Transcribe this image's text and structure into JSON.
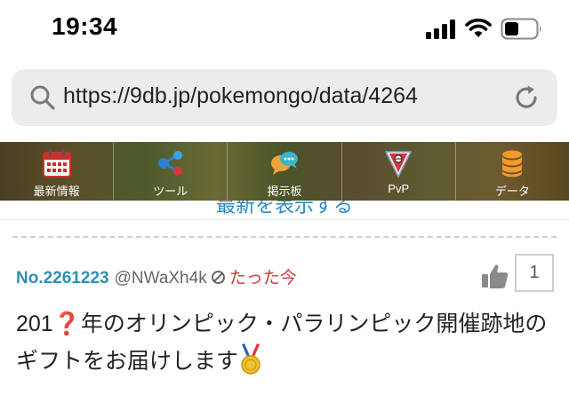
{
  "status_bar": {
    "time": "19:34"
  },
  "address_bar": {
    "url": "https://9db.jp/pokemongo/data/4264"
  },
  "nav": {
    "items": [
      {
        "label": "最新情報",
        "icon": "calendar-icon"
      },
      {
        "label": "ツール",
        "icon": "share-icon"
      },
      {
        "label": "掲示板",
        "icon": "chat-bubbles-icon"
      },
      {
        "label": "PvP",
        "icon": "league-badge-icon"
      },
      {
        "label": "データ",
        "icon": "database-icon"
      }
    ]
  },
  "refresh_notice": {
    "text": "最新を表示する"
  },
  "post": {
    "number": "No.2261223",
    "user": "@NWaXh4k",
    "time": "たった今",
    "likes": "1",
    "body_part1": "201",
    "body_question": "❓",
    "body_part2": "年のオリンピック・パラリンピック開催跡地のギフトをお届けします"
  },
  "colors": {
    "accent_blue": "#2f8fb4",
    "accent_red": "#d9343b"
  }
}
